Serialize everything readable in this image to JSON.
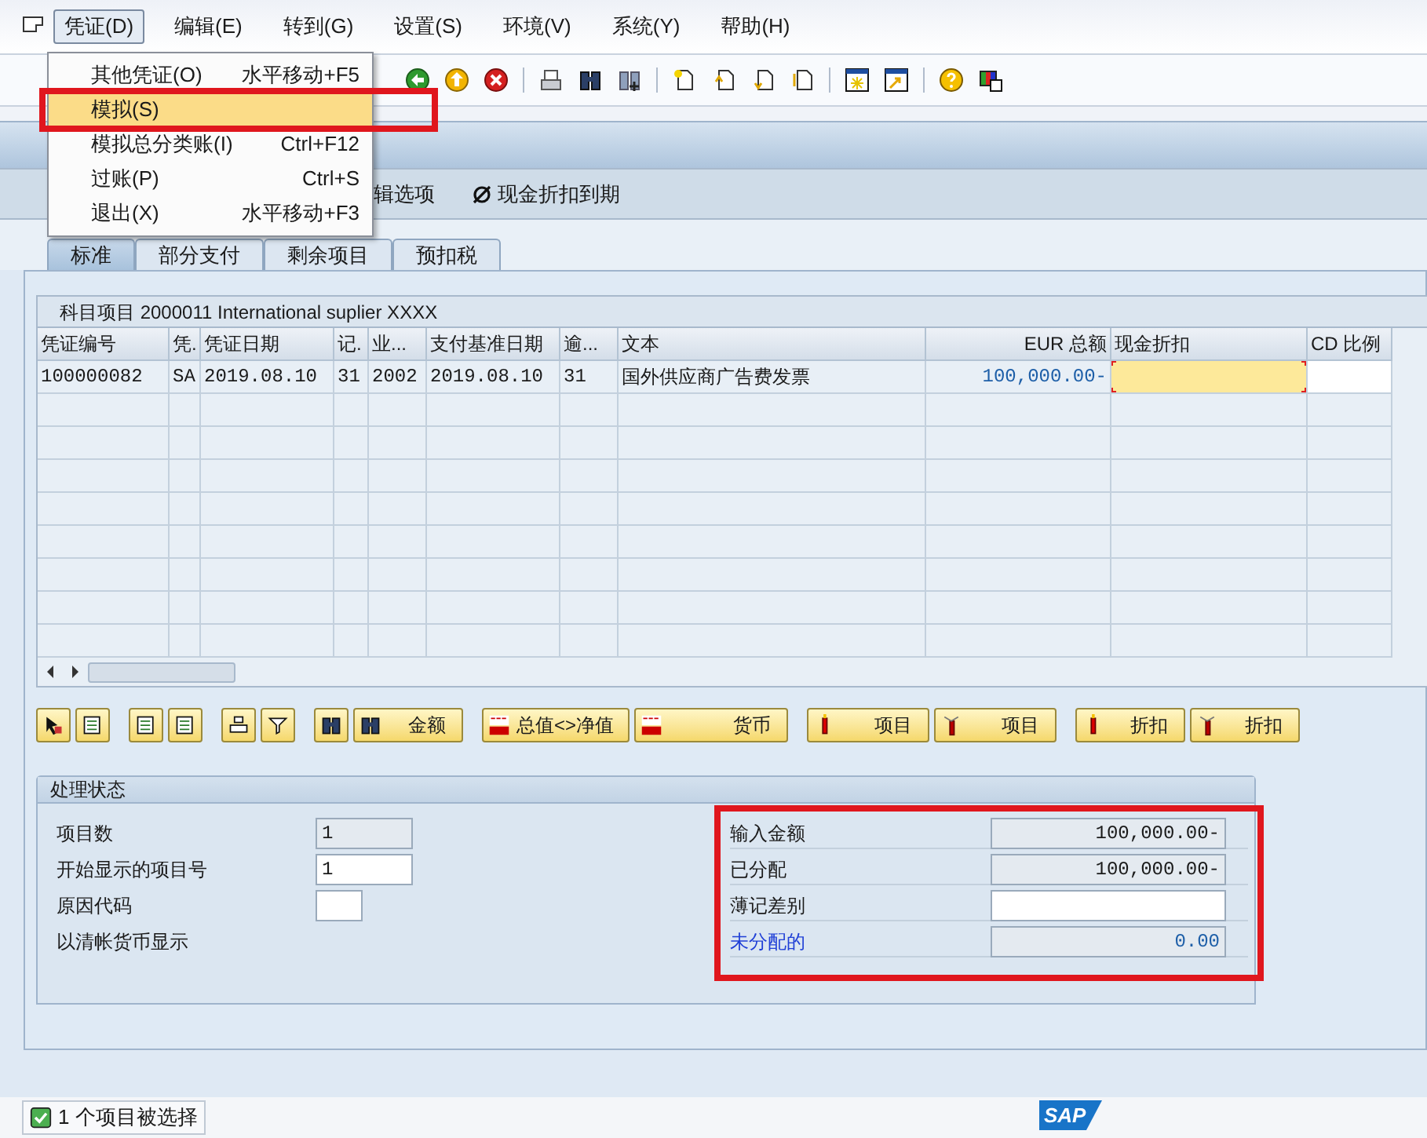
{
  "menubar": {
    "items": [
      {
        "label": "凭证(D)",
        "selected": true
      },
      {
        "label": "编辑(E)",
        "selected": false
      },
      {
        "label": "转到(G)",
        "selected": false
      },
      {
        "label": "设置(S)",
        "selected": false
      },
      {
        "label": "环境(V)",
        "selected": false
      },
      {
        "label": "系统(Y)",
        "selected": false
      },
      {
        "label": "帮助(H)",
        "selected": false
      }
    ]
  },
  "dropdown": {
    "items": [
      {
        "label": "其他凭证(O)",
        "shortcut": "水平移动+F5",
        "selected": false,
        "annotated": false
      },
      {
        "label": "模拟(S)",
        "selected": true,
        "annotated": true
      },
      {
        "label": "模拟总分类账(I)",
        "shortcut": "Ctrl+F12",
        "selected": false,
        "annotated": false
      },
      {
        "label": "过账(P)",
        "shortcut": "Ctrl+S",
        "selected": false,
        "annotated": false
      },
      {
        "label": "退出(X)",
        "shortcut": "水平移动+F3",
        "selected": false,
        "annotated": false
      }
    ]
  },
  "app_toolbar": {
    "items": [
      {
        "label": "辑选项",
        "kind": "text"
      },
      {
        "label": "现金折扣到期",
        "kind": "icon"
      }
    ]
  },
  "tabs": [
    {
      "label": "标准",
      "selected": true
    },
    {
      "label": "部分支付",
      "selected": false
    },
    {
      "label": "剩余项目",
      "selected": false
    },
    {
      "label": "预扣税",
      "selected": false
    }
  ],
  "table": {
    "title": "科目项目 2000011 International suplier XXXX",
    "columns": [
      {
        "label": "凭证编号",
        "kind": "text"
      },
      {
        "label": "凭.",
        "kind": "text"
      },
      {
        "label": "凭证日期",
        "kind": "text"
      },
      {
        "label": "记.",
        "kind": "text"
      },
      {
        "label": "业...",
        "kind": "text"
      },
      {
        "label": "支付基准日期",
        "kind": "text"
      },
      {
        "label": "逾...",
        "kind": "text"
      },
      {
        "label": "文本",
        "kind": "text"
      },
      {
        "label": "EUR 总额",
        "kind": "amount"
      },
      {
        "label": "现金折扣",
        "kind": "focused-input"
      },
      {
        "label": "CD 比例",
        "kind": "input"
      }
    ],
    "rows": [
      {
        "cells": [
          "100000082",
          "SA",
          "2019.08.10",
          "31",
          "2002",
          "2019.08.10",
          "31",
          "国外供应商广告费发票",
          "100,000.00-"
        ]
      }
    ]
  },
  "buttons": [
    {
      "label": "金额",
      "kind": "binoculars"
    },
    {
      "label": "总值<>净值",
      "kind": "money"
    },
    {
      "label": "货币",
      "kind": "money"
    },
    {
      "label": "项目",
      "kind": "pen-up"
    },
    {
      "label": "项目",
      "kind": "pen-down"
    },
    {
      "label": "折扣",
      "kind": "pen-up"
    },
    {
      "label": "折扣",
      "kind": "pen-down"
    }
  ],
  "status_panel": {
    "title": "处理状态",
    "left": [
      {
        "label": "项目数",
        "value": "1",
        "kind": "readonly"
      },
      {
        "label": "开始显示的项目号",
        "value": "1",
        "kind": "input"
      },
      {
        "label": "原因代码",
        "kind": "small-input"
      },
      {
        "label": "以清帐货币显示",
        "kind": "label"
      }
    ],
    "right": [
      {
        "label": "输入金额",
        "value": "100,000.00-",
        "kind": "readonly",
        "emphasized": false
      },
      {
        "label": "已分配",
        "value": "100,000.00-",
        "kind": "readonly",
        "emphasized": false
      },
      {
        "label": "薄记差别",
        "kind": "input",
        "emphasized": false
      },
      {
        "label": "未分配的",
        "value": "0.00",
        "kind": "readonly",
        "emphasized": true
      }
    ],
    "annotated": true
  },
  "status_bar": {
    "message": "1 个项目被选择",
    "checked": true,
    "logo": "SAP"
  }
}
